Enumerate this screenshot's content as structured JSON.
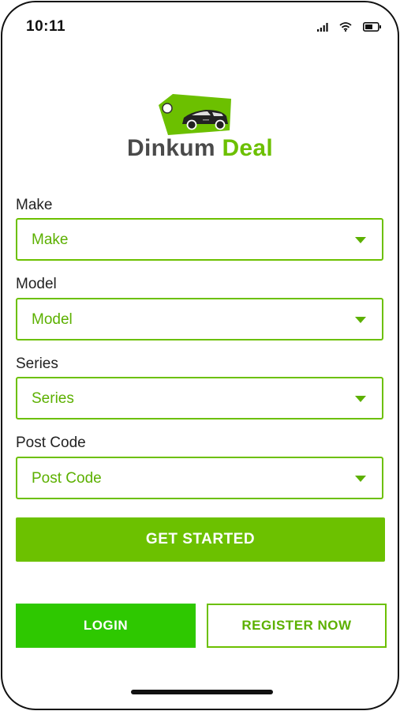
{
  "status_bar": {
    "time": "10:11",
    "icons": [
      "signal-icon",
      "wifi-icon",
      "battery-icon"
    ]
  },
  "logo": {
    "word1": "Dinkum",
    "word2": "Deal",
    "icon": "car-price-tag-icon"
  },
  "form": {
    "make": {
      "label": "Make",
      "value": "Make"
    },
    "model": {
      "label": "Model",
      "value": "Model"
    },
    "series": {
      "label": "Series",
      "value": "Series"
    },
    "postcode": {
      "label": "Post Code",
      "value": "Post Code"
    }
  },
  "buttons": {
    "get_started": "GET STARTED",
    "login": "LOGIN",
    "register": "REGISTER NOW"
  },
  "colors": {
    "accent": "#6cc000",
    "login_green": "#2ec800",
    "logo_gray": "#4a4a4a"
  }
}
